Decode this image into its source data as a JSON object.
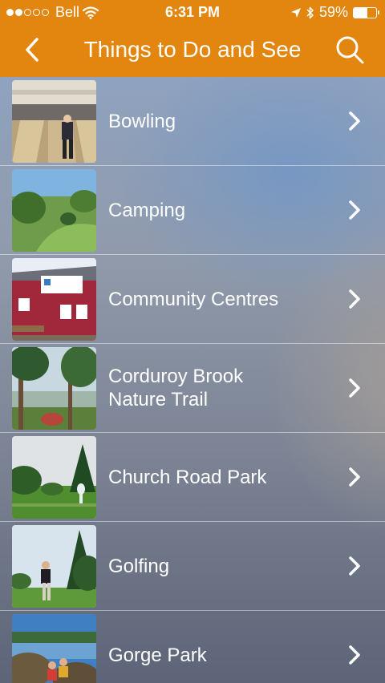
{
  "status": {
    "carrier": "Bell",
    "time": "6:31 PM",
    "battery_percent": "59%",
    "battery_level": 0.59,
    "signal_bars": 2
  },
  "nav": {
    "title": "Things to Do and See",
    "back_icon": "chevron-left-icon",
    "search_icon": "search-icon"
  },
  "colors": {
    "header": "#e3860f",
    "text": "#ffffff"
  },
  "items": [
    {
      "label": "Bowling",
      "thumbnail": "bowling-photo"
    },
    {
      "label": "Camping",
      "thumbnail": "camping-photo"
    },
    {
      "label": "Community Centres",
      "thumbnail": "community-centre-photo"
    },
    {
      "label": "Corduroy Brook\nNature Trail",
      "thumbnail": "nature-trail-photo"
    },
    {
      "label": "Church Road Park",
      "thumbnail": "park-photo"
    },
    {
      "label": "Golfing",
      "thumbnail": "golfing-photo"
    },
    {
      "label": "Gorge Park",
      "thumbnail": "gorge-park-photo"
    }
  ]
}
